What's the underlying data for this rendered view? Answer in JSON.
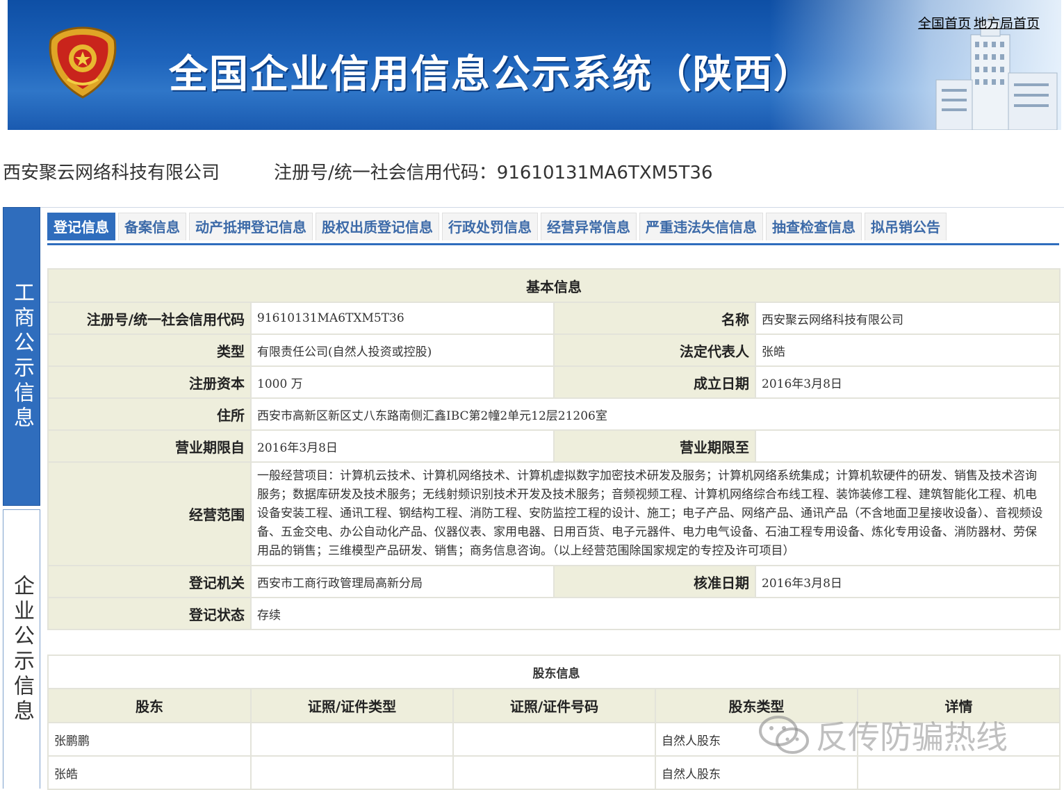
{
  "banner": {
    "title": "全国企业信用信息公示系统（陕西）",
    "link_national": "全国首页",
    "link_local": "地方局首页"
  },
  "company": {
    "name": "西安聚云网络科技有限公司",
    "code_label": "注册号/统一社会信用代码：",
    "code": "91610131MA6TXM5T36"
  },
  "side_nav": {
    "top": "工商公示信息",
    "bottom": "企业公示信息"
  },
  "tabs": [
    {
      "label": "登记信息",
      "active": true
    },
    {
      "label": "备案信息"
    },
    {
      "label": "动产抵押登记信息"
    },
    {
      "label": "股权出质登记信息"
    },
    {
      "label": "行政处罚信息"
    },
    {
      "label": "经营异常信息"
    },
    {
      "label": "严重违法失信信息"
    },
    {
      "label": "抽查检查信息"
    },
    {
      "label": "拟吊销公告"
    }
  ],
  "basic_info": {
    "caption": "基本信息",
    "reg_code_label": "注册号/统一社会信用代码",
    "reg_code": "91610131MA6TXM5T36",
    "name_label": "名称",
    "name": "西安聚云网络科技有限公司",
    "type_label": "类型",
    "type": "有限责任公司(自然人投资或控股)",
    "legal_rep_label": "法定代表人",
    "legal_rep": "张皓",
    "capital_label": "注册资本",
    "capital": "1000 万",
    "founded_label": "成立日期",
    "founded": "2016年3月8日",
    "address_label": "住所",
    "address": "西安市高新区新区丈八东路南侧汇鑫IBC第2幢2单元12层21206室",
    "term_from_label": "营业期限自",
    "term_from": "2016年3月8日",
    "term_to_label": "营业期限至",
    "term_to": "",
    "scope_label": "经营范围",
    "scope": "一般经营项目：计算机云技术、计算机网络技术、计算机虚拟数字加密技术研发及服务；计算机网络系统集成；计算机软硬件的研发、销售及技术咨询服务；数据库研发及技术服务；无线射频识别技术开发及技术服务；音频视频工程、计算机网络综合布线工程、装饰装修工程、建筑智能化工程、机电设备安装工程、通讯工程、钢结构工程、消防工程、安防监控工程的设计、施工；电子产品、网络产品、通讯产品（不含地面卫星接收设备）、音视频设备、五金交电、办公自动化产品、仪器仪表、家用电器、日用百货、电子元器件、电力电气设备、石油工程专用设备、炼化专用设备、消防器材、劳保用品的销售；三维模型产品研发、销售；商务信息咨询。（以上经营范围除国家规定的专控及许可项目）",
    "authority_label": "登记机关",
    "authority": "西安市工商行政管理局高新分局",
    "approved_label": "核准日期",
    "approved": "2016年3月8日",
    "status_label": "登记状态",
    "status": "存续"
  },
  "shareholders": {
    "caption": "股东信息",
    "headers": [
      "股东",
      "证照/证件类型",
      "证照/证件号码",
      "股东类型",
      "详情"
    ],
    "rows": [
      [
        "张鹏鹏",
        "",
        "",
        "自然人股东",
        ""
      ],
      [
        "张皓",
        "",
        "",
        "自然人股东",
        ""
      ]
    ]
  },
  "watermark": "反传防骗热线"
}
